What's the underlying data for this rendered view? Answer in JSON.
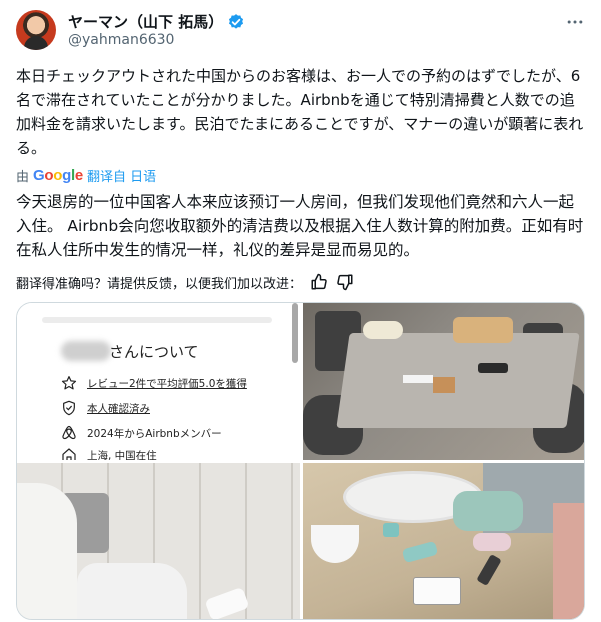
{
  "header": {
    "display_name": "ヤーマン（山下 拓馬）",
    "handle": "@yahman6630",
    "more_icon": "more-horizontal-icon",
    "verified_icon": "verified-badge-icon",
    "verified_color": "#1d9bf0"
  },
  "tweet": {
    "text": "本日チェックアウトされた中国からのお客様は、お一人での予約のはずでしたが、6名で滞在されていたことが分かりました。Airbnbを通じて特別清掃費と人数での追加料金を請求いたします。民泊でたまにあることですが、マナーの違いが顕著に表れる。"
  },
  "translation": {
    "prefix": "由",
    "google": "Google",
    "link": "翻译自 日语",
    "text": "今天退房的一位中国客人本来应该预订一人房间，但我们发现他们竟然和六人一起入住。 Airbnb会向您收取额外的清洁费以及根据入住人数计算的附加费。正如有时在私人住所中发生的情况一样，礼仪的差异是显而易见的。"
  },
  "feedback": {
    "question": "翻译得准确吗？请提供反馈，以便我们加以改进：",
    "thumbs_up_icon": "thumbs-up-icon",
    "thumbs_down_icon": "thumbs-down-icon"
  },
  "media": {
    "profile_card": {
      "title": "さんについて",
      "rows": [
        {
          "icon": "star-icon",
          "text": "レビュー2件で平均評価5.0を獲得",
          "underline": true
        },
        {
          "icon": "shield-check-icon",
          "text": "本人確認済み",
          "underline": true
        },
        {
          "icon": "airbnb-icon",
          "text": "2024年からAirbnbメンバー",
          "underline": false
        },
        {
          "icon": "home-icon",
          "text": "上海, 中国在住",
          "underline": false
        }
      ]
    },
    "photos": [
      {
        "name": "messy-table-photo"
      },
      {
        "name": "bathroom-floor-photo"
      },
      {
        "name": "sink-counter-photo"
      }
    ]
  },
  "colors": {
    "text_primary": "#0f1419",
    "text_secondary": "#536471",
    "link": "#1d9bf0",
    "border": "#cfd9de"
  }
}
